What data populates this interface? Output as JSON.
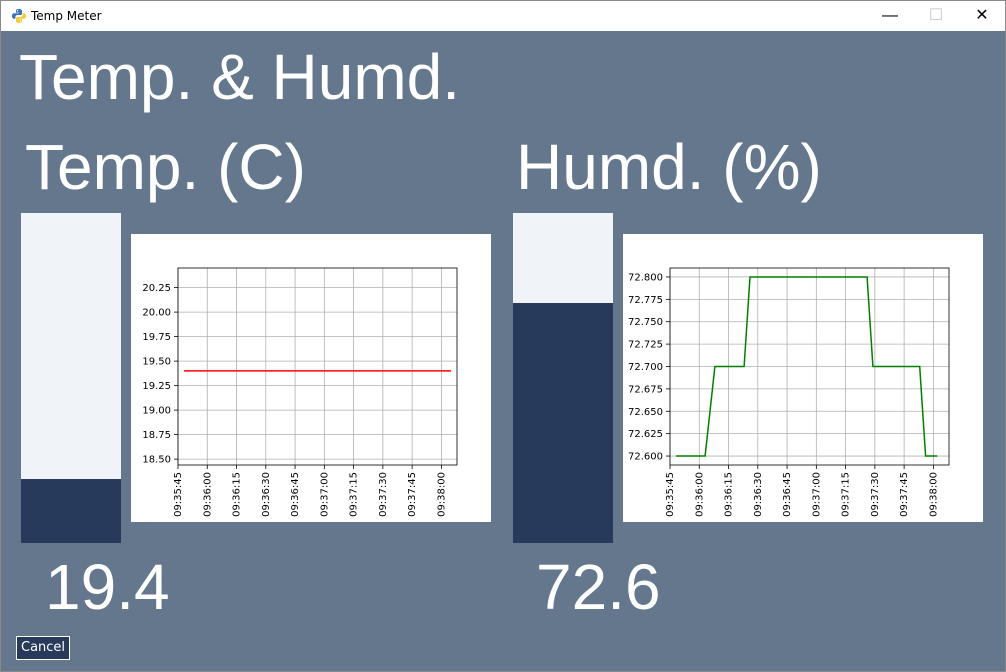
{
  "window": {
    "title": "Temp Meter",
    "minimize_glyph": "—",
    "maximize_glyph": "☐",
    "close_glyph": "✕",
    "app_icon": "python-icon"
  },
  "main_title": "Temp. & Humd.",
  "temperature": {
    "heading": "Temp. (C)",
    "value_text": "19.4",
    "meter_fill": 0.194,
    "meter_fill_color": "#283a5b",
    "meter_track_color": "#f0f3f8"
  },
  "humidity": {
    "heading": "Humd. (%)",
    "value_text": "72.6",
    "meter_fill": 0.726,
    "meter_fill_color": "#283a5b",
    "meter_track_color": "#f0f3f8"
  },
  "cancel_label": "Cancel",
  "colors": {
    "background": "#64778d",
    "temp_line": "#ff0000",
    "humd_line": "#008000"
  },
  "chart_data": [
    {
      "type": "line",
      "x_ticks": [
        "09:35:45",
        "09:36:00",
        "09:36:15",
        "09:36:30",
        "09:36:45",
        "09:37:00",
        "09:37:15",
        "09:37:30",
        "09:37:45",
        "09:38:00"
      ],
      "y_ticks": [
        "18.50",
        "18.75",
        "19.00",
        "19.25",
        "19.50",
        "19.75",
        "20.00",
        "20.25"
      ],
      "xlim": [
        "09:35:45",
        "09:38:08"
      ],
      "ylim": [
        18.44,
        20.45
      ],
      "grid": true,
      "series": [
        {
          "color": "#ff0000",
          "x": [
            "09:35:48",
            "09:38:05"
          ],
          "y": [
            19.4,
            19.4
          ]
        }
      ]
    },
    {
      "type": "line",
      "x_ticks": [
        "09:35:45",
        "09:36:00",
        "09:36:15",
        "09:36:30",
        "09:36:45",
        "09:37:00",
        "09:37:15",
        "09:37:30",
        "09:37:45",
        "09:38:00"
      ],
      "y_ticks": [
        "72.600",
        "72.625",
        "72.650",
        "72.675",
        "72.700",
        "72.725",
        "72.750",
        "72.775",
        "72.800"
      ],
      "xlim": [
        "09:35:45",
        "09:38:08"
      ],
      "ylim": [
        72.59,
        72.81
      ],
      "grid": true,
      "series": [
        {
          "color": "#008000",
          "x": [
            "09:35:48",
            "09:36:03",
            "09:36:08",
            "09:36:23",
            "09:36:26",
            "09:37:26",
            "09:37:29",
            "09:37:53",
            "09:37:56",
            "09:38:02"
          ],
          "y": [
            72.6,
            72.6,
            72.7,
            72.7,
            72.8,
            72.8,
            72.7,
            72.7,
            72.6,
            72.6
          ]
        }
      ]
    }
  ]
}
